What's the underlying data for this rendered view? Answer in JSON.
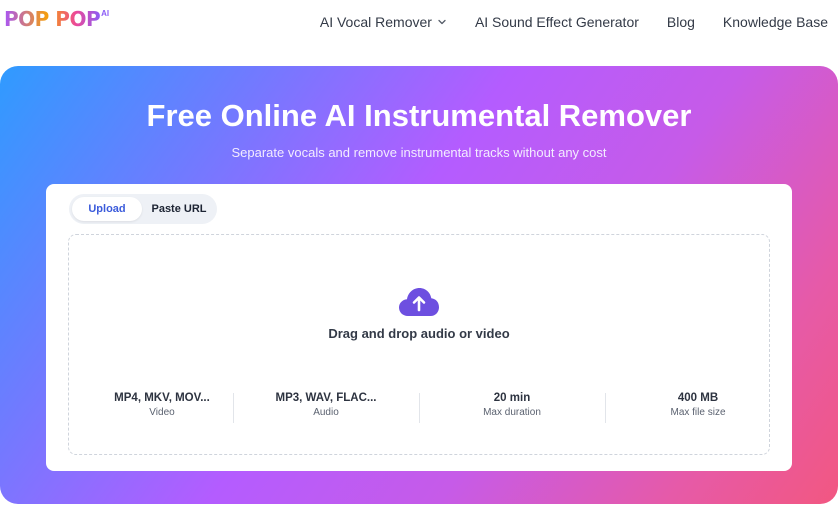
{
  "brand": {
    "logo_text": "POP POP",
    "logo_badge": "AI"
  },
  "nav": {
    "items": [
      {
        "label": "AI Vocal Remover",
        "has_dropdown": true
      },
      {
        "label": "AI Sound Effect Generator"
      },
      {
        "label": "Blog"
      },
      {
        "label": "Knowledge Base"
      }
    ]
  },
  "hero": {
    "title": "Free Online AI Instrumental Remover",
    "subtitle": "Separate vocals and remove instrumental tracks without any cost"
  },
  "uploader": {
    "tabs": [
      {
        "label": "Upload",
        "active": true
      },
      {
        "label": "Paste URL",
        "active": false
      }
    ],
    "icon": "cloud-upload-icon",
    "drop_text": "Drag and drop audio or video",
    "specs": [
      {
        "value": "MP4, MKV, MOV...",
        "label": "Video"
      },
      {
        "value": "MP3, WAV, FLAC...",
        "label": "Audio"
      },
      {
        "value": "20 min",
        "label": "Max duration"
      },
      {
        "value": "400 MB",
        "label": "Max file size"
      }
    ]
  },
  "colors": {
    "accent": "#3b5bdb",
    "icon": "#6d4fe0",
    "hero_start": "#2f9bff",
    "hero_mid": "#b45cff",
    "hero_end": "#f25781"
  }
}
